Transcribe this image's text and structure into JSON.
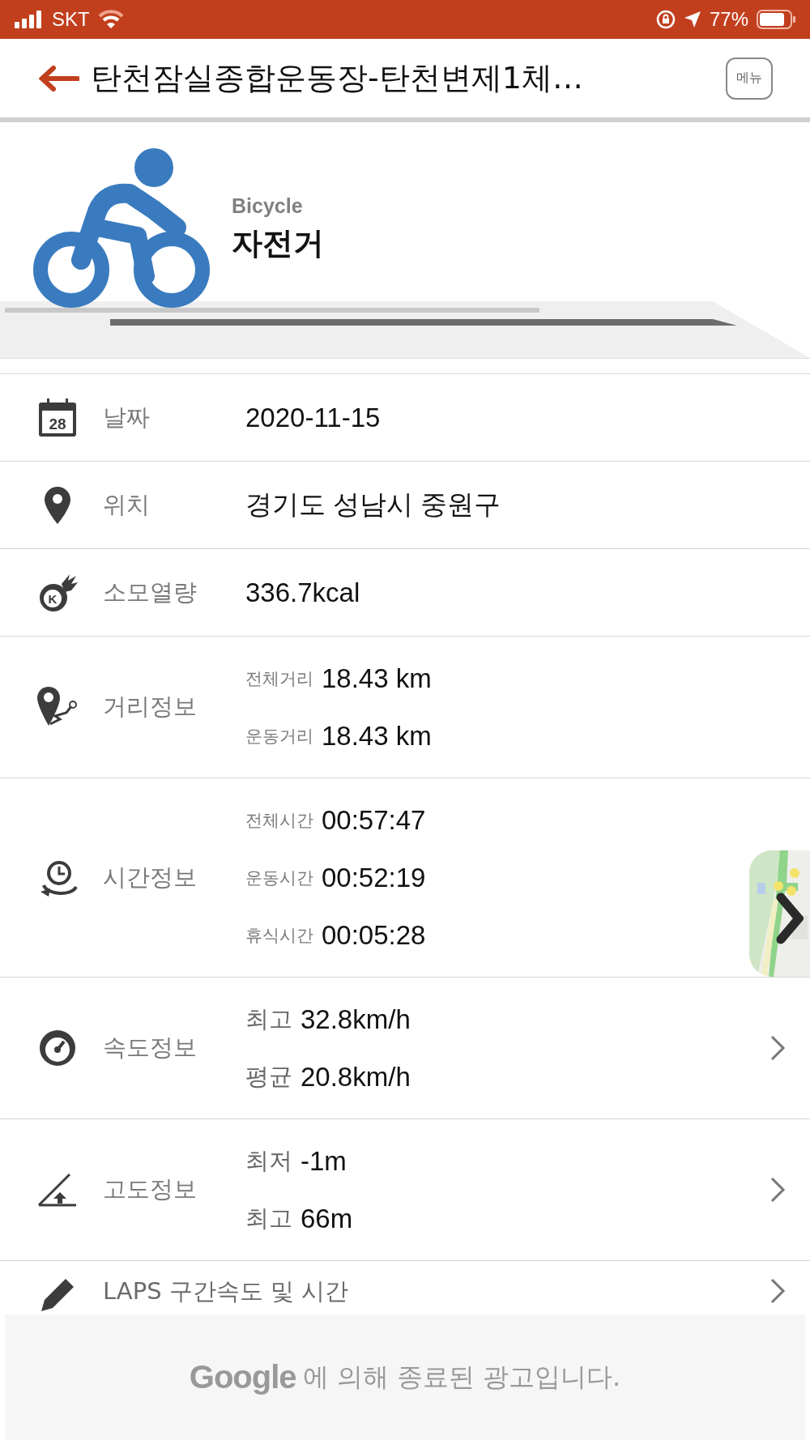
{
  "status_bar": {
    "carrier": "SKT",
    "battery": "77%"
  },
  "header": {
    "title": "탄천잠실종합운동장-탄천변제1체…",
    "menu_button": "메뉴"
  },
  "activity": {
    "name_en": "Bicycle",
    "name": "자전거"
  },
  "rows": [
    {
      "kind": "value",
      "label": "날짜",
      "icon_text": "28",
      "value": "2020-11-15",
      "chevron": false
    },
    {
      "kind": "value",
      "label": "위치",
      "value": "경기도 성남시 중원구",
      "chevron": false
    },
    {
      "kind": "value",
      "label": "소모열량",
      "icon_text": "K",
      "value": "336.7kcal",
      "chevron": false
    },
    {
      "kind": "details",
      "label": "거리정보",
      "items": [
        {
          "label": "전체거리",
          "value": "18.43 km"
        },
        {
          "label": "운동거리",
          "value": "18.43 km"
        }
      ],
      "chevron": false
    },
    {
      "kind": "details",
      "label": "시간정보",
      "items": [
        {
          "label": "전체시간",
          "value": "00:57:47"
        },
        {
          "label": "운동시간",
          "value": "00:52:19"
        },
        {
          "label": "휴식시간",
          "value": "00:05:28"
        }
      ],
      "chevron": false,
      "map_preview": true
    },
    {
      "kind": "summary",
      "label": "속도정보",
      "items": [
        {
          "label": "최고",
          "value": "32.8km/h"
        },
        {
          "label": "평균",
          "value": "20.8km/h"
        }
      ],
      "chevron": true
    },
    {
      "kind": "summary",
      "label": "고도정보",
      "items": [
        {
          "label": "최저",
          "value": "-1m"
        },
        {
          "label": "최고",
          "value": "66m"
        }
      ],
      "chevron": true
    },
    {
      "kind": "link",
      "label": "LAPS 구간속도 및 시간",
      "chevron": true
    }
  ],
  "ad_notice": {
    "logo": "Google",
    "message": "에 의해 종료된 광고입니다."
  }
}
